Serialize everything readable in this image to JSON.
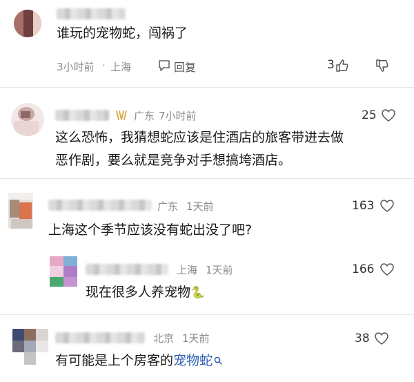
{
  "comments": [
    {
      "body": "谁玩的宠物蛇，闯祸了",
      "time": "3小时前",
      "location": "上海",
      "reply_label": "回复",
      "like_count": "3"
    },
    {
      "location": "广东",
      "time": "7小时前",
      "like_count": "25",
      "body_line1": "这么恐怖，我猜想蛇应该是住酒店的旅客带进去做",
      "body_line2": "恶作剧，要么就是竞争对手想搞垮酒店。"
    },
    {
      "location": "广东",
      "time": "1天前",
      "like_count": "163",
      "body": "上海这个季节应该没有蛇出没了吧?"
    },
    {
      "location": "上海",
      "time": "1天前",
      "like_count": "166",
      "body": "现在很多人养宠物",
      "emoji": "🐍"
    },
    {
      "location": "北京",
      "time": "1天前",
      "like_count": "38",
      "body_prefix": "有可能是上个房客的",
      "body_link": "宠物蛇",
      "link_icon": "search-icon"
    }
  ],
  "colors": {
    "link": "#2b5fb3",
    "meta": "#8a8a8a",
    "vip": "#d9a441"
  }
}
